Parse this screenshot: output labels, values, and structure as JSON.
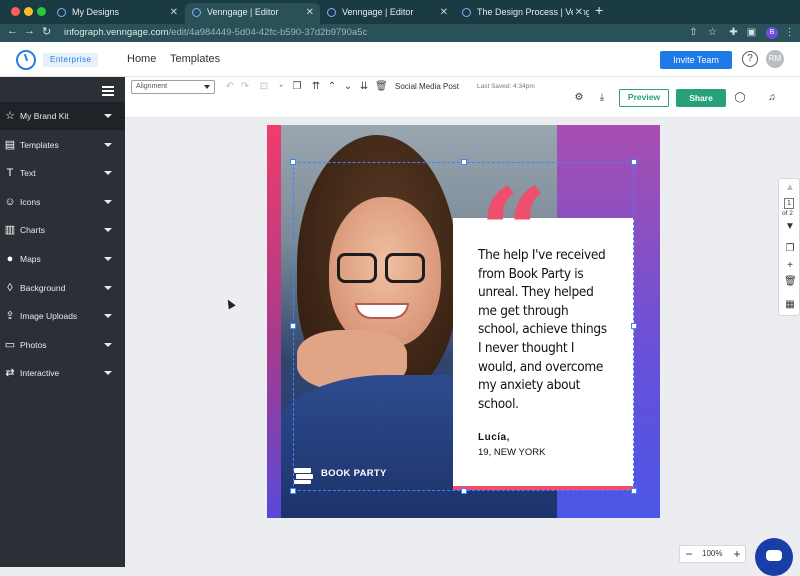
{
  "browser": {
    "tabs": [
      {
        "title": "My Designs",
        "active": false
      },
      {
        "title": "Venngage | Editor",
        "active": true
      },
      {
        "title": "Venngage | Editor",
        "active": false
      },
      {
        "title": "The Design Process | Venngage",
        "active": false
      }
    ],
    "url_main": "infograph.venngage.com",
    "url_path": "/edit/4a984449-5d04-42fc-b590-37d2b9790a5c",
    "profile_initial": "B"
  },
  "header": {
    "plan_badge": "Enterprise",
    "nav": [
      "Home",
      "Templates"
    ],
    "invite_label": "Invite Team",
    "help_label": "?",
    "avatar_initials": "RM"
  },
  "sidebar": {
    "items": [
      {
        "label": "My Brand Kit",
        "icon": "star-icon",
        "glyph": "☆"
      },
      {
        "label": "Templates",
        "icon": "templates-icon",
        "glyph": "▤"
      },
      {
        "label": "Text",
        "icon": "text-icon",
        "glyph": "T"
      },
      {
        "label": "Icons",
        "icon": "icons-icon",
        "glyph": "☺"
      },
      {
        "label": "Charts",
        "icon": "charts-icon",
        "glyph": "▥"
      },
      {
        "label": "Maps",
        "icon": "map-pin-icon",
        "glyph": "●"
      },
      {
        "label": "Background",
        "icon": "background-icon",
        "glyph": "◊"
      },
      {
        "label": "Image Uploads",
        "icon": "upload-icon",
        "glyph": "⇪"
      },
      {
        "label": "Photos",
        "icon": "photos-icon",
        "glyph": "▭"
      },
      {
        "label": "Interactive",
        "icon": "interactive-icon",
        "glyph": "⇄"
      }
    ]
  },
  "toolbar": {
    "alignment_placeholder": "Alignment",
    "doc_type": "Social Media Post",
    "last_saved": "Last Saved: 4:34pm",
    "preview_label": "Preview",
    "share_label": "Share"
  },
  "design": {
    "quote_lines": [
      "The help I've received",
      "from Book Party is",
      "unreal. They helped",
      "me get through",
      "school, achieve things",
      "I never thought I",
      "would, and overcome",
      "my anxiety about",
      "school."
    ],
    "author_name": "Lucía,",
    "author_location": "19, NEW YORK",
    "brand_name": "BOOK PARTY",
    "quote_color": "#ef4f6c"
  },
  "pages": {
    "current": "1",
    "of_label": "of 2"
  },
  "zoom": {
    "value": "100%"
  },
  "colors": {
    "accent_green": "#27a17b",
    "accent_blue": "#1e7ae6",
    "sidebar_bg": "#2b3036"
  }
}
